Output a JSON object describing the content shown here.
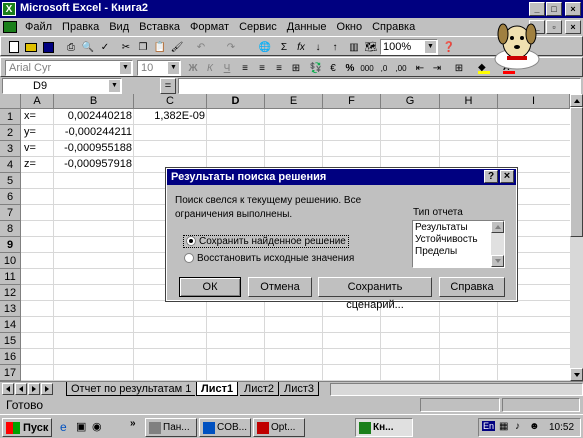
{
  "window": {
    "title": "Microsoft Excel - Книга2"
  },
  "menu": [
    "Файл",
    "Правка",
    "Вид",
    "Вставка",
    "Формат",
    "Сервис",
    "Данные",
    "Окно",
    "Справка"
  ],
  "toolbar": {
    "zoom": "100%"
  },
  "format_toolbar": {
    "font": "Arial Cyr",
    "size": "10",
    "bold": "Ж",
    "italic": "К",
    "underline": "Ч",
    "percent": "%",
    "thousands": "000"
  },
  "formula_bar": {
    "name_box": "D9",
    "equals": "="
  },
  "columns": [
    "A",
    "B",
    "C",
    "D",
    "E",
    "F",
    "G",
    "H",
    "I"
  ],
  "rows": [
    "1",
    "2",
    "3",
    "4",
    "5",
    "6",
    "7",
    "8",
    "9",
    "10",
    "11",
    "12",
    "13",
    "14",
    "15",
    "16",
    "17"
  ],
  "cells": {
    "A1": "x=",
    "B1": "0,002440218",
    "C1": "1,382E-09",
    "A2": "y=",
    "B2": "-0,000244211",
    "A3": "v=",
    "B3": "-0,000955188",
    "A4": "z=",
    "B4": "-0,000957918"
  },
  "dialog": {
    "title": "Результаты поиска решения",
    "message": "Поиск свелся к текущему решению. Все ограничения выполнены.",
    "report_type_label": "Тип отчета",
    "reports": [
      "Результаты",
      "Устойчивость",
      "Пределы"
    ],
    "option_keep": "Сохранить найденное решение",
    "option_restore": "Восстановить исходные значения",
    "btn_ok": "ОК",
    "btn_cancel": "Отмена",
    "btn_save_scenario": "Сохранить сценарий...",
    "btn_help": "Справка",
    "help_icon": "?",
    "close_icon": "×"
  },
  "sheet_tabs": [
    "Отчет по результатам 1",
    "Лист1",
    "Лист2",
    "Лист3"
  ],
  "status": {
    "text": "Готово"
  },
  "taskbar": {
    "start": "Пуск",
    "tasks": [
      "Пан...",
      "COB...",
      "Opt...",
      "Кн..."
    ],
    "lang": "En",
    "clock": "10:52"
  }
}
